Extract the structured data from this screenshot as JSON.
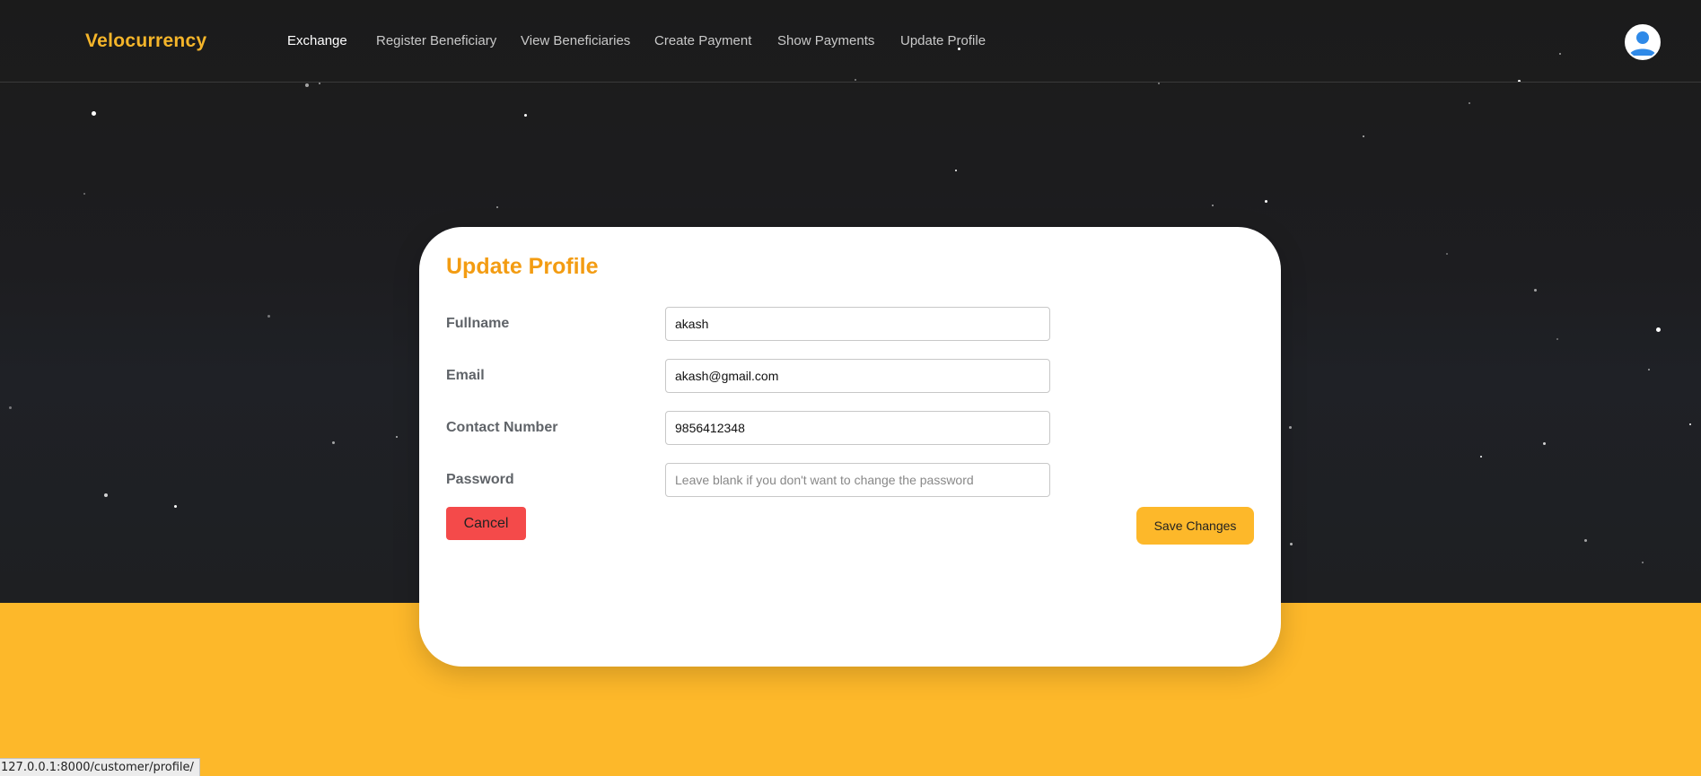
{
  "brand": "Velocurrency",
  "nav": {
    "items": [
      {
        "label": "Exchange",
        "active": true
      },
      {
        "label": "Register Beneficiary",
        "active": false
      },
      {
        "label": "View Beneficiaries",
        "active": false
      },
      {
        "label": "Create Payment",
        "active": false
      },
      {
        "label": "Show Payments",
        "active": false
      },
      {
        "label": "Update Profile",
        "active": false
      }
    ],
    "avatar_icon": "user-avatar-icon"
  },
  "form": {
    "title": "Update Profile",
    "fields": [
      {
        "label": "Fullname",
        "value": "akash",
        "placeholder": ""
      },
      {
        "label": "Email",
        "value": "akash@gmail.com",
        "placeholder": ""
      },
      {
        "label": "Contact Number",
        "value": "9856412348",
        "placeholder": ""
      },
      {
        "label": "Password",
        "value": "",
        "placeholder": "Leave blank if you don't want to change the password"
      }
    ],
    "cancel_label": "Cancel",
    "save_label": "Save Changes"
  },
  "status_bar": {
    "url": "127.0.0.1:8000/customer/profile/"
  },
  "colors": {
    "brand": "#f5b52a",
    "title": "#f39c12",
    "accent": "#fdb82a",
    "danger": "#f44a4a",
    "hero_bg": "#1b1b1b"
  }
}
